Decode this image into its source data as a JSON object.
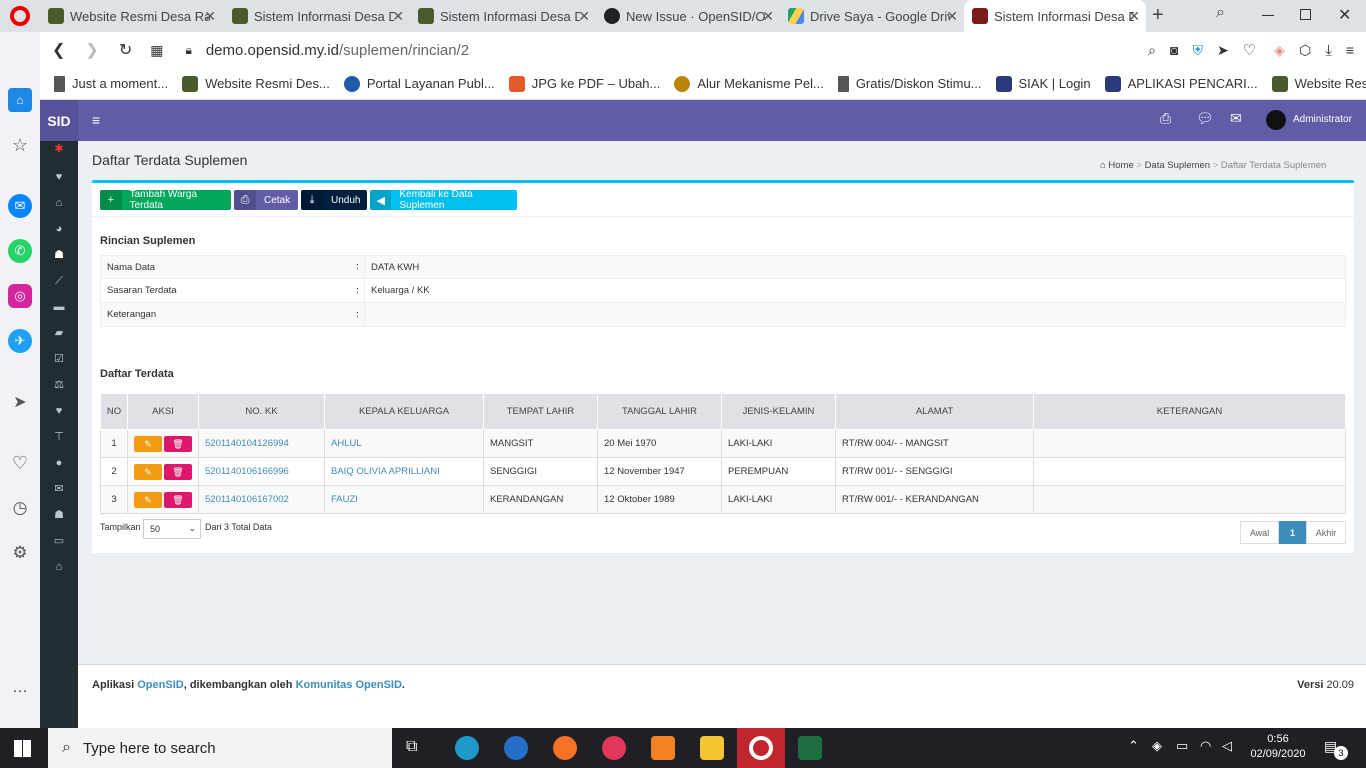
{
  "browser": {
    "tabs": [
      {
        "label": "Website Resmi Desa Ran",
        "color": "#4a5a2a"
      },
      {
        "label": "Sistem Informasi Desa D",
        "color": "#4a5a2a"
      },
      {
        "label": "Sistem Informasi Desa D",
        "color": "#4a5a2a"
      },
      {
        "label": "New Issue · OpenSID/Op",
        "color": "#222"
      },
      {
        "label": "Drive Saya - Google Driv",
        "color": "#1fa463"
      },
      {
        "label": "Sistem Informasi Desa D",
        "color": "#7a1a1a"
      }
    ],
    "url_host": "demo.opensid.my.id",
    "url_path": "/suplemen/rincian/2",
    "bookmarks": [
      "Just a moment...",
      "Website Resmi Des...",
      "Portal Layanan Publ...",
      "JPG ke PDF – Ubah...",
      "Alur Mekanisme Pel...",
      "Gratis/Diskon Stimu...",
      "SIAK | Login",
      "APLIKASI PENCARI...",
      "Website Resmi Desa"
    ]
  },
  "app": {
    "brand": "SID",
    "user": "Administrator",
    "page_title": "Daftar Terdata Suplemen",
    "breadcrumb": {
      "home": "Home",
      "mid": "Data Suplemen",
      "current": "Daftar Terdata Suplemen"
    },
    "buttons": {
      "add": "Tambah Warga Terdata",
      "print": "Cetak",
      "download": "Unduh",
      "back": "Kembali ke Data Suplemen"
    },
    "detail_heading": "Rincian Suplemen",
    "details": [
      {
        "label": "Nama Data",
        "sep": ":",
        "value": "DATA KWH"
      },
      {
        "label": "Sasaran Terdata",
        "sep": ":",
        "value": "Keluarga / KK"
      },
      {
        "label": "Keterangan",
        "sep": ":",
        "value": ""
      }
    ],
    "list_heading": "Daftar Terdata",
    "columns": [
      "NO",
      "AKSI",
      "NO. KK",
      "KEPALA KELUARGA",
      "TEMPAT LAHIR",
      "TANGGAL LAHIR",
      "JENIS-KELAMIN",
      "ALAMAT",
      "KETERANGAN"
    ],
    "rows": [
      {
        "no": "1",
        "kk": "5201140104126994",
        "kepala": "AHLUL",
        "tempat": "MANGSIT",
        "tanggal": "20 Mei 1970",
        "jk": "LAKI-LAKI",
        "alamat": "RT/RW 004/- - MANGSIT",
        "ket": ""
      },
      {
        "no": "2",
        "kk": "5201140106166996",
        "kepala": "BAIQ OLIVIA APRILLIANI",
        "tempat": "SENGGIGI",
        "tanggal": "12 November 1947",
        "jk": "PEREMPUAN",
        "alamat": "RT/RW 001/- - SENGGIGI",
        "ket": ""
      },
      {
        "no": "3",
        "kk": "5201140106167002",
        "kepala": "FAUZI",
        "tempat": "KERANDANGAN",
        "tanggal": "12 Oktober 1989",
        "jk": "LAKI-LAKI",
        "alamat": "RT/RW 001/- - KERANDANGAN",
        "ket": ""
      }
    ],
    "pager": {
      "show_label": "Tampilkan",
      "per_page": "50",
      "total": "Dari 3 Total Data",
      "first": "Awal",
      "current": "1",
      "last": "Akhir"
    },
    "footer": {
      "prefix": "Aplikasi",
      "app": "OpenSID",
      "mid": ", dikembangkan oleh",
      "org": "Komunitas OpenSID",
      "end": ".",
      "version_label": "Versi",
      "version": "20.09"
    }
  },
  "taskbar": {
    "search": "Type here to search",
    "time": "0:56",
    "date": "02/09/2020",
    "notif": "3"
  },
  "colors": {
    "purple": "#605ca8",
    "green": "#00a65a",
    "orange": "#f39c12",
    "pink": "#dd1769",
    "cyan": "#00c0ef",
    "link": "#3c8dbc"
  }
}
